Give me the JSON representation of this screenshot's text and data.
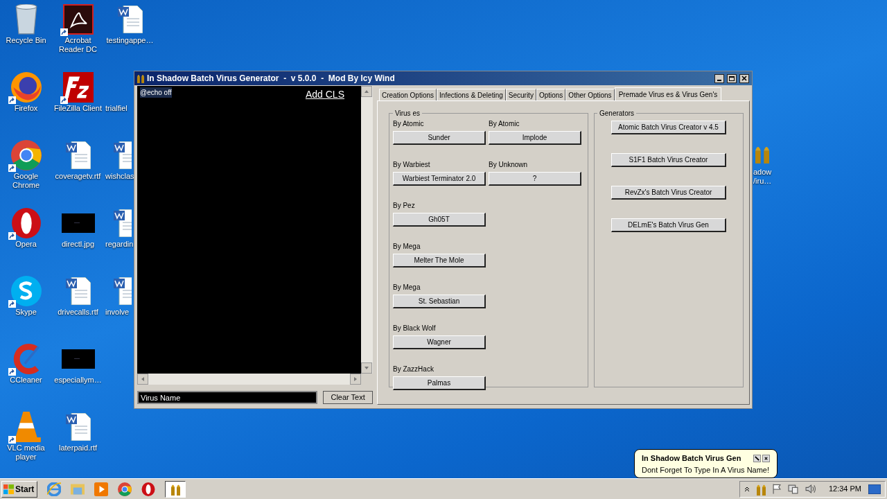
{
  "desktop_columns": [
    [
      {
        "label": "Recycle Bin",
        "kind": "recycle",
        "shortcut": false
      },
      {
        "label": "Firefox",
        "kind": "firefox",
        "shortcut": true
      },
      {
        "label": "Google Chrome",
        "kind": "chrome",
        "shortcut": true
      },
      {
        "label": "Opera",
        "kind": "opera",
        "shortcut": true
      },
      {
        "label": "Skype",
        "kind": "skype",
        "shortcut": true
      },
      {
        "label": "CCleaner",
        "kind": "ccleaner",
        "shortcut": true
      },
      {
        "label": "VLC media player",
        "kind": "vlc",
        "shortcut": true
      }
    ],
    [
      {
        "label": "Acrobat Reader DC",
        "kind": "pdf",
        "shortcut": true
      },
      {
        "label": "FileZilla Client",
        "kind": "filezilla",
        "shortcut": true
      },
      {
        "label": "coveragetv.rtf",
        "kind": "word",
        "shortcut": false
      },
      {
        "label": "directl.jpg",
        "shortcut": false
      },
      {
        "label": "drivecalls.rtf",
        "kind": "word",
        "shortcut": false
      },
      {
        "label": "especiallym…",
        "shortcut": false
      },
      {
        "label": "laterpaid.rtf",
        "kind": "word",
        "shortcut": false
      }
    ],
    [
      {
        "label": "testingappe…",
        "kind": "word",
        "shortcut": false
      },
      {
        "label": "trialfiel",
        "kind": "blank",
        "shortcut": false
      },
      {
        "label": "wishclas",
        "kind": "word",
        "shortcut": false
      },
      {
        "label": "regardin",
        "kind": "word",
        "shortcut": false
      },
      {
        "label": "involve",
        "kind": "word",
        "shortcut": false
      }
    ]
  ],
  "right_icon": {
    "label": "adow\n/iru…",
    "kind": "bullets"
  },
  "window": {
    "title": "In Shadow Batch Virus Generator  -  v 5.0.0  -  Mod By Icy Wind",
    "editor_text": "@echo off",
    "add_cls": "Add CLS",
    "name_field": {
      "value": "Virus Name"
    },
    "clear_button": "Clear Text",
    "tabs": [
      {
        "label": "Creation Options",
        "selected": false
      },
      {
        "label": "Infections & Deleting",
        "selected": false
      },
      {
        "label": "Security",
        "selected": false
      },
      {
        "label": "Options",
        "selected": false
      },
      {
        "label": "Other Options",
        "selected": false
      },
      {
        "label": "Premade Virus es & Virus Gen's",
        "selected": true
      }
    ],
    "viruses_group": {
      "title": "Virus es",
      "rows": [
        [
          {
            "author": "By Atomic",
            "name": "Sunder"
          },
          {
            "author": "By Atomic",
            "name": "Implode"
          }
        ],
        [
          {
            "author": "By Warbiest",
            "name": "Warbiest Terminator 2.0"
          },
          {
            "author": "By Unknown",
            "name": "?"
          }
        ],
        [
          {
            "author": "By Pez",
            "name": "Gh05T"
          }
        ],
        [
          {
            "author": "By Mega",
            "name": "Melter The Mole"
          }
        ],
        [
          {
            "author": "By Mega",
            "name": "St. Sebastian"
          }
        ],
        [
          {
            "author": "By Black Wolf",
            "name": "Wagner"
          }
        ],
        [
          {
            "author": "By ZazzHack",
            "name": "Palmas"
          }
        ]
      ]
    },
    "generators_group": {
      "title": "Generators",
      "buttons": [
        "Atomic Batch Virus Creator v 4.5",
        "S1F1 Batch Virus Creator",
        "RevZx's Batch Virus Creator",
        "DELmE's Batch Virus Gen"
      ]
    }
  },
  "balloon": {
    "title": "In Shadow Batch Virus Gen",
    "message": "Dont Forget To Type In A Virus Name!"
  },
  "taskbar": {
    "start": "Start",
    "quick_launch": [
      {
        "kind": "ie"
      },
      {
        "kind": "explorer"
      },
      {
        "kind": "media"
      },
      {
        "kind": "chrome"
      },
      {
        "kind": "opera"
      }
    ],
    "apps": [
      {
        "kind": "bullets",
        "selected": true
      }
    ],
    "clock": "12:34 PM"
  }
}
